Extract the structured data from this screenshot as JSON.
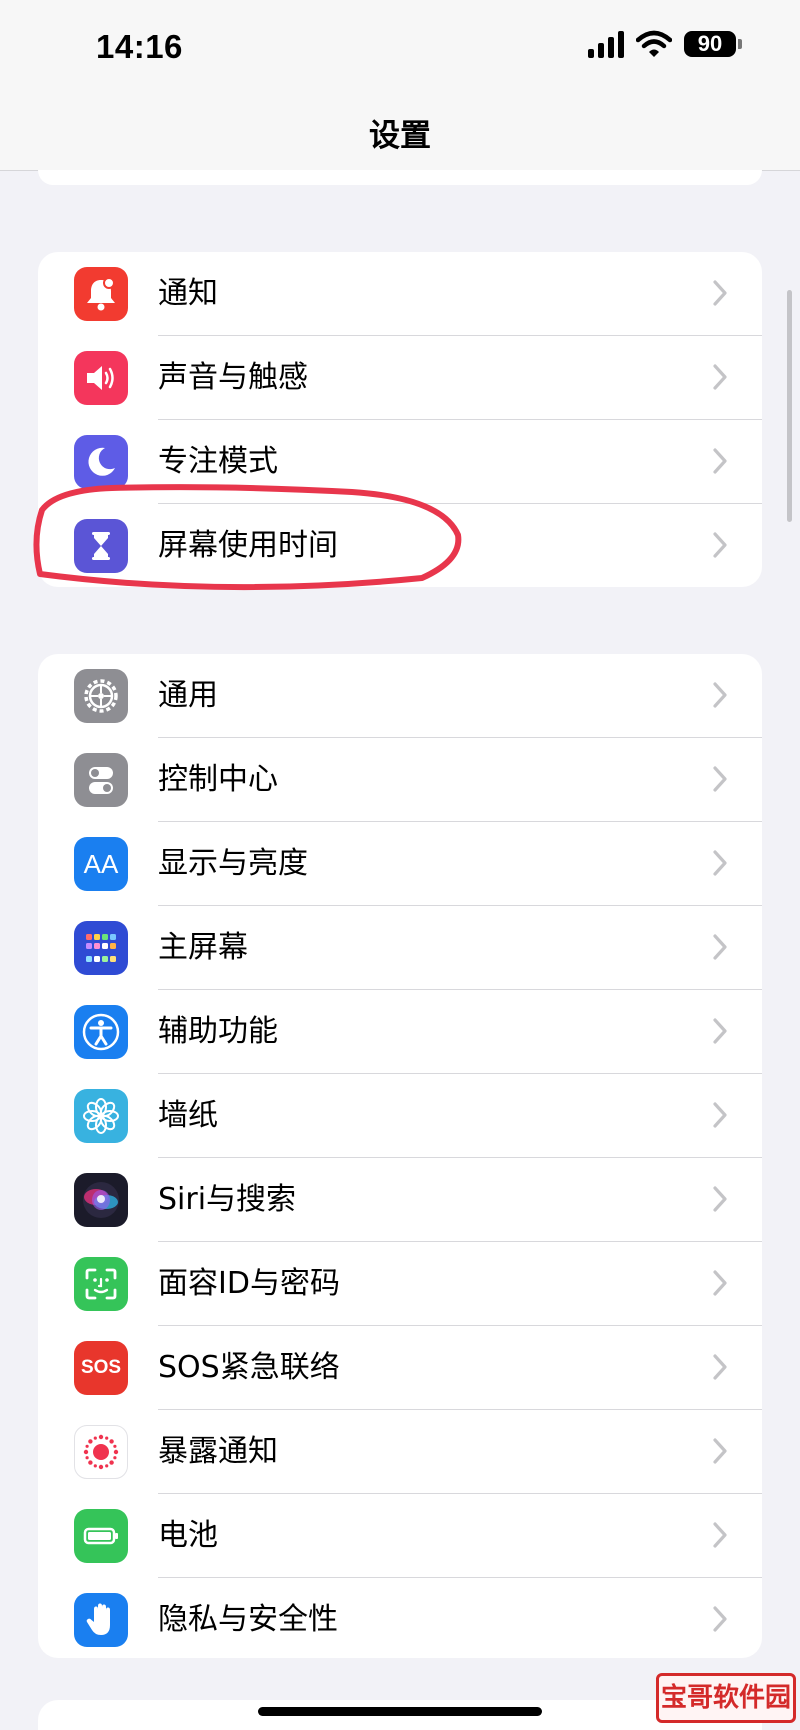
{
  "status_bar": {
    "time": "14:16",
    "battery": "90"
  },
  "nav": {
    "title": "设置"
  },
  "groups": [
    {
      "items": [
        {
          "label": "通知",
          "icon": "bell-icon",
          "color": "#f23b30"
        },
        {
          "label": "声音与触感",
          "icon": "speaker-icon",
          "color": "#f4365c"
        },
        {
          "label": "专注模式",
          "icon": "moon-icon",
          "color": "#5e5ce6"
        },
        {
          "label": "屏幕使用时间",
          "icon": "hourglass-icon",
          "color": "#5b55d6"
        }
      ]
    },
    {
      "items": [
        {
          "label": "通用",
          "icon": "gear-icon",
          "color": "#8e8e93"
        },
        {
          "label": "控制中心",
          "icon": "toggles-icon",
          "color": "#8e8e93"
        },
        {
          "label": "显示与亮度",
          "icon": "text-size-icon",
          "color": "#1a7ff0"
        },
        {
          "label": "主屏幕",
          "icon": "home-grid-icon",
          "color": "#2f4bd4"
        },
        {
          "label": "辅助功能",
          "icon": "accessibility-icon",
          "color": "#1a7ff0"
        },
        {
          "label": "墙纸",
          "icon": "flower-icon",
          "color": "#38b2e0"
        },
        {
          "label": "Siri与搜索",
          "icon": "siri-icon",
          "color": "#1b1b2a"
        },
        {
          "label": "面容ID与密码",
          "icon": "face-id-icon",
          "color": "#35c459"
        },
        {
          "label": "SOS紧急联络",
          "icon": "sos-icon",
          "color": "#e8362c",
          "icon_text": "SOS"
        },
        {
          "label": "暴露通知",
          "icon": "exposure-icon",
          "color": "#ffffff"
        },
        {
          "label": "电池",
          "icon": "battery-icon",
          "color": "#35c459"
        },
        {
          "label": "隐私与安全性",
          "icon": "hand-icon",
          "color": "#1a7ff0"
        }
      ]
    }
  ],
  "icon_texts": {
    "display": "AA"
  },
  "watermark": "宝哥软件园",
  "accent": {
    "highlight_stroke": "#e8364c"
  }
}
